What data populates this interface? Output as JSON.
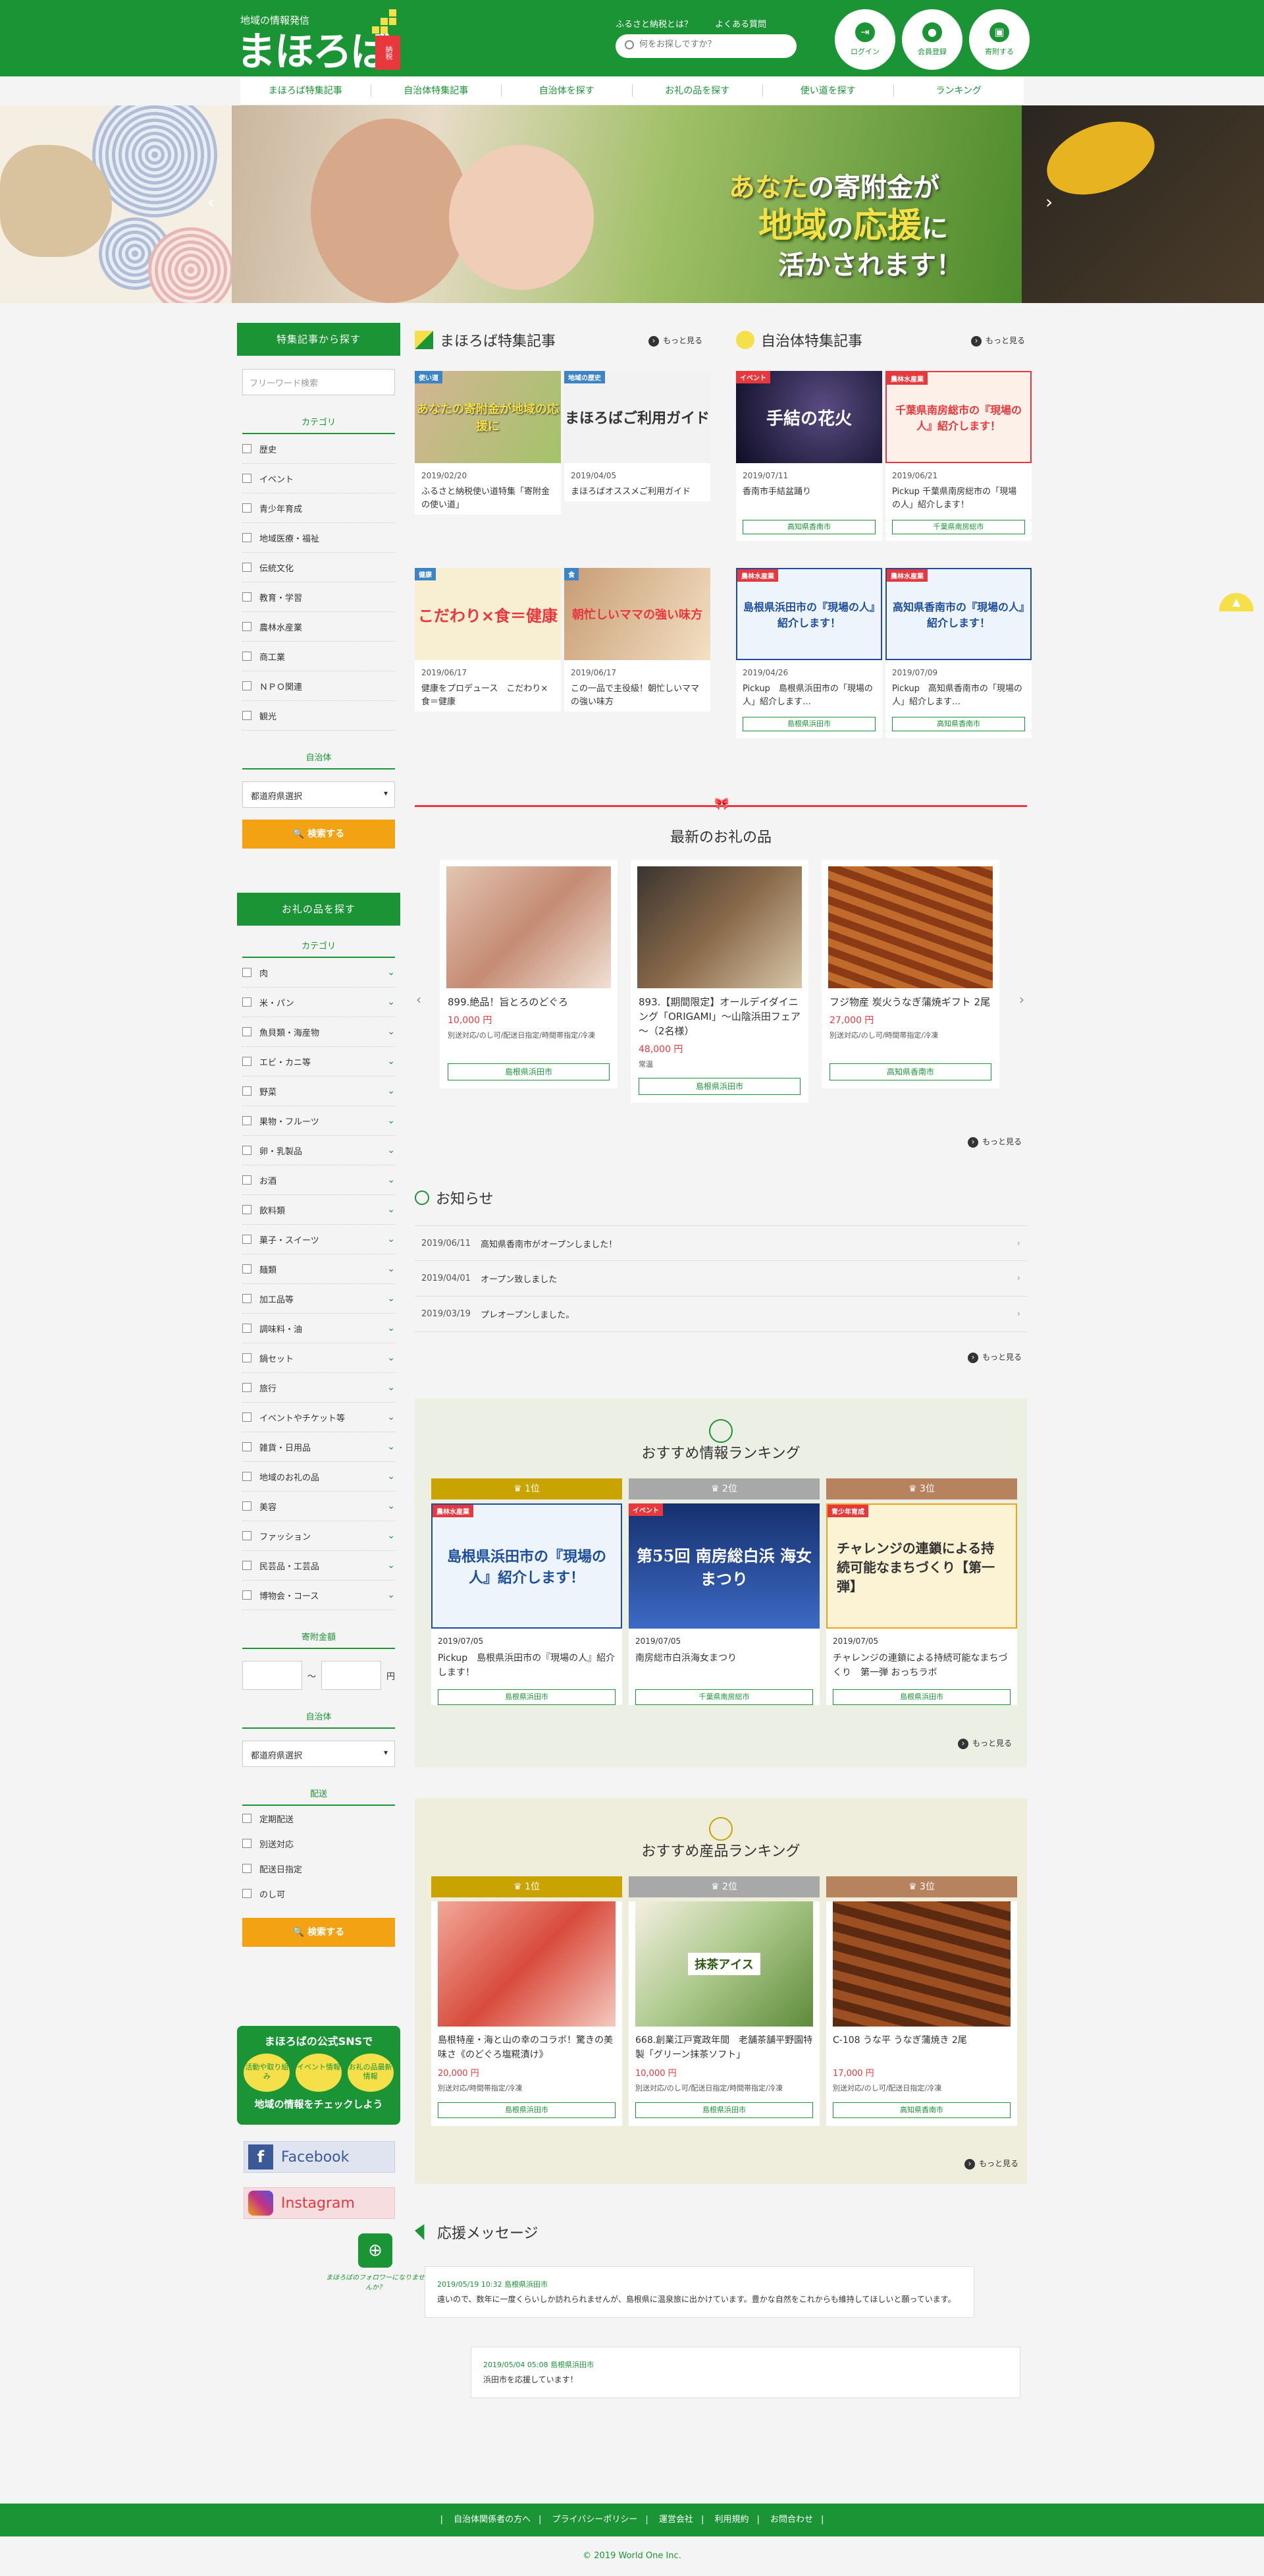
{
  "header": {
    "logo_sub": "地域の情報発信",
    "logo_main": "まほろば",
    "logo_badge": "納税",
    "toplink_about": "ふるさと納税とは？",
    "toplink_faq": "よくある質問",
    "search_placeholder": "何をお探しですか？",
    "btn_login": "ログイン",
    "btn_register": "会員登録",
    "btn_cart": "寄附する"
  },
  "nav": [
    "まほろば特集記事",
    "自治体特集記事",
    "自治体を探す",
    "お礼の品を探す",
    "使い道を探す",
    "ランキング"
  ],
  "hero": {
    "line1_a": "あなた",
    "line1_b": "の寄附金が",
    "line2_a": "地域",
    "line2_b": "の",
    "line2_c": "応援",
    "line2_d": "に",
    "line3": "活かされます！"
  },
  "sidebar1": {
    "title": "特集記事から探す",
    "keyword_placeholder": "フリーワード検索",
    "cat_title": "カテゴリ",
    "categories": [
      "歴史",
      "イベント",
      "青少年育成",
      "地域医療・福祉",
      "伝統文化",
      "教育・学習",
      "農林水産業",
      "商工業",
      "ＮＰＯ関連",
      "観光"
    ],
    "muni_title": "自治体",
    "muni_select": "都道府県選択",
    "search_btn": "検索する"
  },
  "sidebar2": {
    "title": "お礼の品を探す",
    "cat_title": "カテゴリ",
    "categories": [
      "肉",
      "米・パン",
      "魚貝類・海産物",
      "エビ・カニ等",
      "野菜",
      "果物・フルーツ",
      "卵・乳製品",
      "お酒",
      "飲料類",
      "菓子・スイーツ",
      "麺類",
      "加工品等",
      "調味料・油",
      "鍋セット",
      "旅行",
      "イベントやチケット等",
      "雑貨・日用品",
      "地域のお礼の品",
      "美容",
      "ファッション",
      "民芸品・工芸品",
      "博物会・コース"
    ],
    "amount_title": "寄附金額",
    "amount_sep": "〜",
    "amount_unit": "円",
    "muni_title": "自治体",
    "muni_select": "都道府県選択",
    "delivery_title": "配送",
    "delivery": [
      "定期配送",
      "別送対応",
      "配送日指定",
      "のし可"
    ],
    "search_btn": "検索する"
  },
  "sns": {
    "title": "まほろばの公式SNSで",
    "bubbles": [
      "活動や取り組み",
      "イベント情報",
      "お礼の品最新情報"
    ],
    "bottom": "地域の情報をチェックしよう",
    "facebook": "Facebook",
    "instagram": "Instagram",
    "follow": "まほろばのフォロワーになりませんか？"
  },
  "mahoroba_feature": {
    "title": "まほろば特集記事",
    "more": "もっと見る",
    "cards": [
      {
        "tag": "使い道",
        "img_text": "あなたの寄附金が地域の応援に",
        "date": "2019/02/20",
        "title": "ふるさと納税使い道特集「寄附金の使い道」"
      },
      {
        "tag": "地域の歴史",
        "img_text": "まほろばご利用ガイド",
        "date": "2019/04/05",
        "title": "まほろばオススメご利用ガイド"
      },
      {
        "tag": "健康",
        "img_text": "こだわり×食＝健康",
        "date": "2019/06/17",
        "title": "健康をプロデュース　こだわり×食＝健康"
      },
      {
        "tag": "食",
        "img_text": "朝忙しいママの強い味方",
        "date": "2019/06/17",
        "title": "この一品で主役級！朝忙しいママの強い味方"
      }
    ]
  },
  "muni_feature": {
    "title": "自治体特集記事",
    "more": "もっと見る",
    "cards": [
      {
        "tag": "イベント",
        "img_text": "手結の花火",
        "date": "2019/07/11",
        "title": "香南市手結盆踊り",
        "pref": "高知県香南市"
      },
      {
        "tag": "農林水産業",
        "img_text": "千葉県南房総市の『現場の人』紹介します！",
        "date": "2019/06/21",
        "title": "Pickup 千葉県南房総市の「現場の人」紹介します！",
        "pref": "千葉県南房総市"
      },
      {
        "tag": "農林水産業",
        "img_text": "島根県浜田市の『現場の人』紹介します！",
        "date": "2019/04/26",
        "title": "Pickup　島根県浜田市の「現場の人」紹介します…",
        "pref": "島根県浜田市"
      },
      {
        "tag": "農林水産業",
        "img_text": "高知県香南市の『現場の人』紹介します！",
        "date": "2019/07/09",
        "title": "Pickup　高知県香南市の「現場の人」紹介します…",
        "pref": "高知県香南市"
      }
    ]
  },
  "latest_gifts": {
    "title": "最新のお礼の品",
    "more": "もっと見る",
    "items": [
      {
        "name": "899.絶品！旨とろのどぐろ",
        "price": "10,000 円",
        "svc": "別送対応/のし可/配送日指定/時間帯指定/冷凍",
        "pref": "島根県浜田市"
      },
      {
        "name": "893.【期間限定】オールデイダイニング「ORIGAMI」～山陰浜田フェア～（2名様）",
        "price": "48,000 円",
        "svc": "常温",
        "pref": "島根県浜田市"
      },
      {
        "name": "フジ物産 炭火うなぎ蒲焼ギフト 2尾",
        "price": "27,000 円",
        "svc": "別送対応/のし可/時間帯指定/冷凍",
        "pref": "高知県香南市"
      }
    ]
  },
  "news": {
    "title": "お知らせ",
    "more": "もっと見る",
    "rows": [
      {
        "date": "2019/06/11",
        "text": "高知県香南市がオープンしました！"
      },
      {
        "date": "2019/04/01",
        "text": "オープン致しました"
      },
      {
        "date": "2019/03/19",
        "text": "プレオープンしました。"
      }
    ]
  },
  "info_ranking": {
    "title": "おすすめ情報ランキング",
    "more": "もっと見る",
    "items": [
      {
        "rank": "1位",
        "tag": "農林水産業",
        "img_text": "島根県浜田市の『現場の人』紹介します！",
        "date": "2019/07/05",
        "title": "Pickup　島根県浜田市の『現場の人』紹介します！",
        "pref": "島根県浜田市"
      },
      {
        "rank": "2位",
        "tag": "イベント",
        "img_text": "第55回 南房総白浜 海女まつり",
        "date": "2019/07/05",
        "title": "南房総市白浜海女まつり",
        "pref": "千葉県南房総市"
      },
      {
        "rank": "3位",
        "tag": "青少年育成",
        "img_text": "チャレンジの連鎖による持続可能なまちづくり【第一弾】",
        "date": "2019/07/05",
        "title": "チャレンジの連鎖による持続可能なまちづくり　第一弾 おっちラボ",
        "pref": "島根県浜田市"
      }
    ]
  },
  "product_ranking": {
    "title": "おすすめ産品ランキング",
    "more": "もっと見る",
    "items": [
      {
        "rank": "1位",
        "name": "島根特産・海と山の幸のコラボ！驚きの美味さ《のどぐろ塩糀漬け》",
        "price": "20,000 円",
        "svc": "別送対応/時間帯指定/冷凍",
        "pref": "島根県浜田市"
      },
      {
        "rank": "2位",
        "img_text": "抹茶アイス",
        "name": "668.創業江戸寛政年間　老舗茶舗平野園特製「グリーン抹茶ソフト」",
        "price": "10,000 円",
        "svc": "別送対応/のし可/配送日指定/時間帯指定/冷凍",
        "pref": "島根県浜田市"
      },
      {
        "rank": "3位",
        "name": "C-108 うな平 うなぎ蒲焼き 2尾",
        "price": "17,000 円",
        "svc": "別送対応/のし可/配送日指定/冷凍",
        "pref": "高知県香南市"
      }
    ]
  },
  "messages": {
    "title": "応援メッセージ",
    "items": [
      {
        "head": "2019/05/19 10:32 島根県浜田市",
        "body": "遠いので、数年に一度くらいしか訪れられませんが、島根県に温泉旅に出かけています。豊かな自然をこれからも維持してほしいと願っています。"
      },
      {
        "head": "2019/05/04 05:08 島根県浜田市",
        "body": "浜田市を応援しています！"
      }
    ]
  },
  "footer": {
    "links": [
      "自治体関係者の方へ",
      "プライバシーポリシー",
      "運営会社",
      "利用規約",
      "お問合わせ"
    ],
    "copyright": "© 2019 World One Inc."
  },
  "colors": {
    "brand_green": "#1a9435",
    "accent_orange": "#f2a213",
    "accent_yellow": "#f6e04a",
    "price_red": "#e8383d"
  }
}
